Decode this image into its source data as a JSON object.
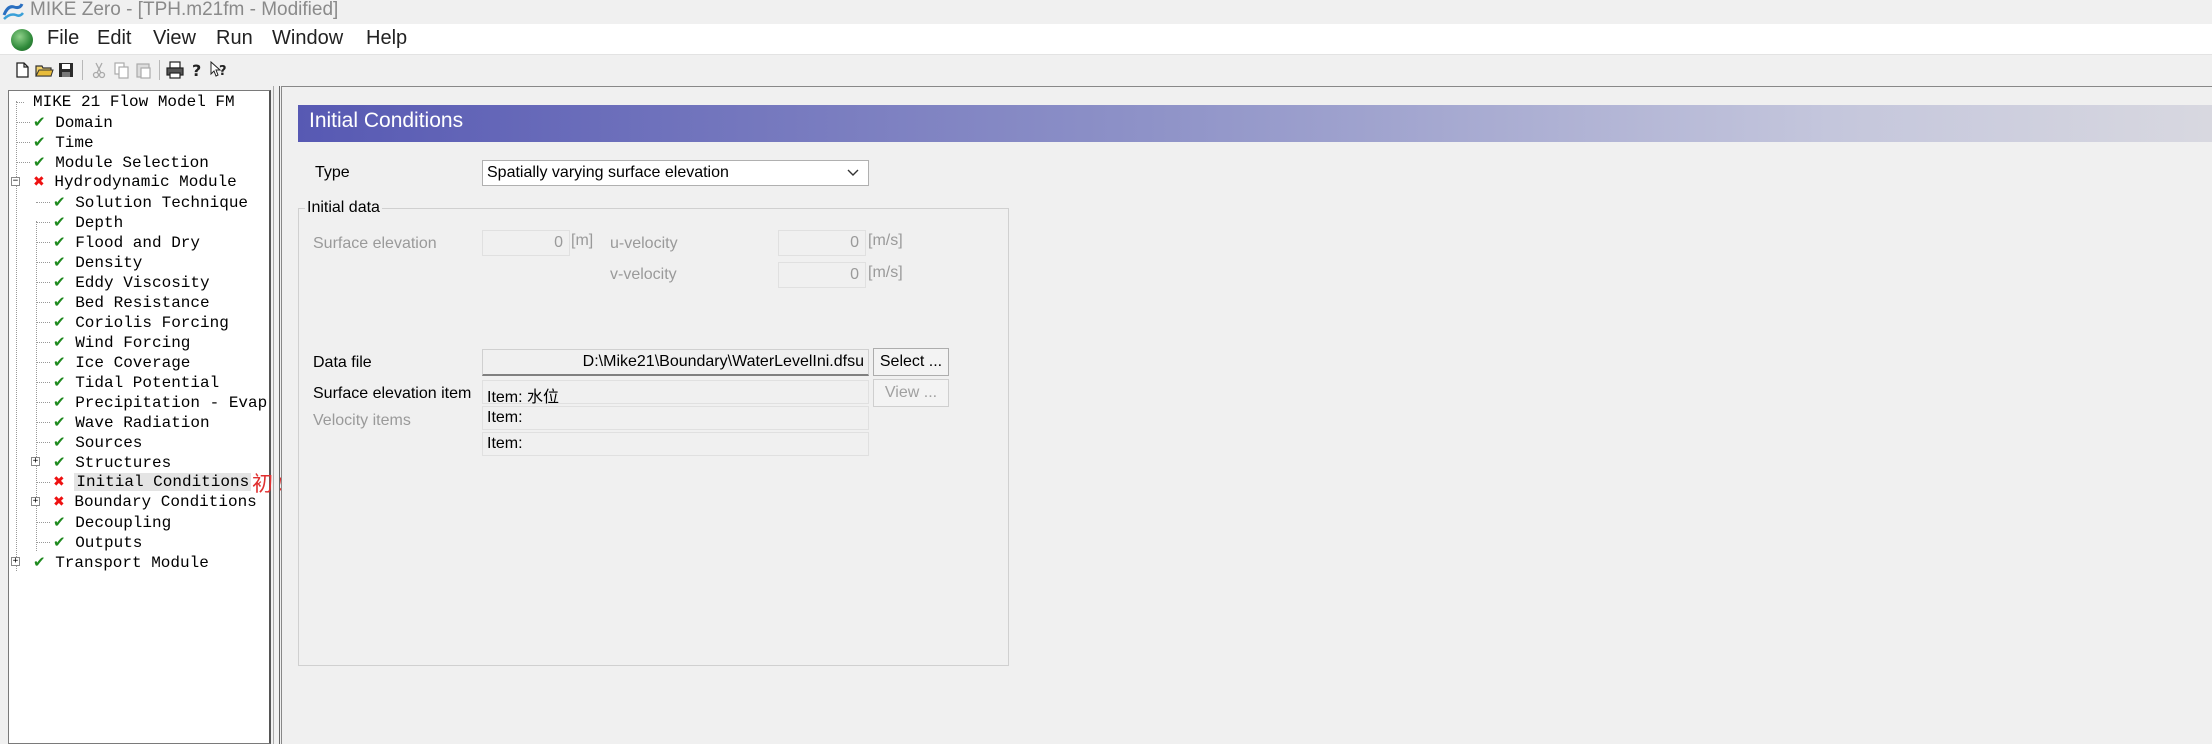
{
  "window": {
    "title": "MIKE Zero - [TPH.m21fm - Modified]"
  },
  "menu": [
    "File",
    "Edit",
    "View",
    "Run",
    "Window",
    "Help"
  ],
  "toolbar": {
    "buttons": [
      "new-file-icon",
      "open-folder-icon",
      "save-icon",
      "cut-icon",
      "copy-icon",
      "paste-icon",
      "print-icon",
      "help-icon",
      "context-help-icon"
    ]
  },
  "tree": {
    "root": "MIKE 21 Flow Model FM",
    "items": [
      {
        "label": "Domain",
        "status": "ok"
      },
      {
        "label": "Time",
        "status": "ok"
      },
      {
        "label": "Module Selection",
        "status": "ok"
      },
      {
        "label": "Hydrodynamic Module",
        "status": "error"
      },
      {
        "label": "Solution Technique",
        "status": "ok"
      },
      {
        "label": "Depth",
        "status": "ok"
      },
      {
        "label": "Flood and Dry",
        "status": "ok"
      },
      {
        "label": "Density",
        "status": "ok"
      },
      {
        "label": "Eddy Viscosity",
        "status": "ok"
      },
      {
        "label": "Bed Resistance",
        "status": "ok"
      },
      {
        "label": "Coriolis Forcing",
        "status": "ok"
      },
      {
        "label": "Wind Forcing",
        "status": "ok"
      },
      {
        "label": "Ice Coverage",
        "status": "ok"
      },
      {
        "label": "Tidal Potential",
        "status": "ok"
      },
      {
        "label": "Precipitation - Evapor",
        "status": "ok"
      },
      {
        "label": "Wave Radiation",
        "status": "ok"
      },
      {
        "label": "Sources",
        "status": "ok"
      },
      {
        "label": "Structures",
        "status": "ok"
      },
      {
        "label": "Initial Conditions",
        "status": "error",
        "selected": true
      },
      {
        "label": "Boundary Conditions",
        "status": "error"
      },
      {
        "label": "Decoupling",
        "status": "ok"
      },
      {
        "label": "Outputs",
        "status": "ok"
      },
      {
        "label": "Transport Module",
        "status": "ok"
      }
    ],
    "annotation": "初始条件"
  },
  "panel": {
    "title": "Initial Conditions",
    "type_label": "Type",
    "type_value": "Spatially varying surface elevation",
    "group_label": "Initial data",
    "surface_elevation_label": "Surface elevation",
    "surface_elevation_value": "0",
    "surface_elevation_unit": "[m]",
    "u_velocity_label": "u-velocity",
    "u_velocity_value": "0",
    "u_velocity_unit": "[m/s]",
    "v_velocity_label": "v-velocity",
    "v_velocity_value": "0",
    "v_velocity_unit": "[m/s]",
    "data_file_label": "Data file",
    "data_file_value": "D:\\Mike21\\Boundary\\WaterLevelIni.dfsu",
    "select_button": "Select ...",
    "surface_item_label": "Surface elevation item",
    "surface_item_value": "Item:   水位",
    "view_button": "View ...",
    "velocity_items_label": "Velocity items",
    "velocity_item_1": "Item:",
    "velocity_item_2": "Item:"
  },
  "colors": {
    "ok": "#1f8a1f",
    "error": "#e11111",
    "header_start": "#5759b3",
    "annotation": "#e03030"
  }
}
